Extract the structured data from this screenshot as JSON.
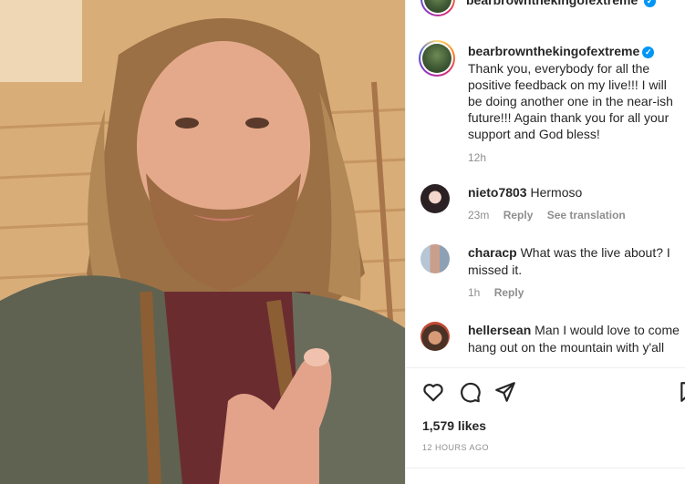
{
  "post": {
    "username": "bearbrownthekingofextreme",
    "more_glyph": "•",
    "verified_glyph": "✓",
    "caption": "Thank you, everybody for all the positive feedback on my live!!! I will be doing another one in the near-ish future!!! Again thank you for all your support and God bless!",
    "caption_time": "12h"
  },
  "comments": [
    {
      "username": "nieto7803",
      "text": "Hermoso",
      "time": "23m",
      "reply_label": "Reply",
      "translate_label": "See translation"
    },
    {
      "username": "characp",
      "text": "What was the live about? I missed it.",
      "time": "1h",
      "reply_label": "Reply"
    },
    {
      "username": "hellersean",
      "text": "Man I would love to come hang out on the mountain with y'all"
    }
  ],
  "actions": {
    "like_icon": "heart-icon",
    "comment_icon": "comment-icon",
    "share_icon": "share-icon",
    "save_icon": "bookmark-icon"
  },
  "likes": "1,579 likes",
  "posted_ago": "12 HOURS AGO",
  "colors": {
    "verified": "#0095f6",
    "text": "#262626",
    "muted": "#8e8e8e"
  }
}
